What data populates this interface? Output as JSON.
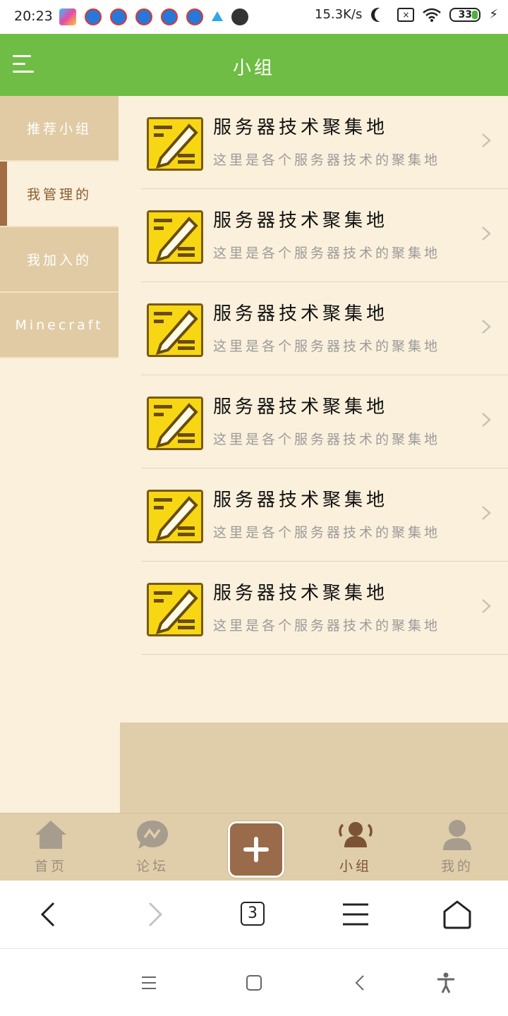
{
  "status_bar": {
    "time": "20:23",
    "net_speed": "15.3K/s",
    "battery": "33"
  },
  "header": {
    "title": "小组"
  },
  "sidebar": {
    "items": [
      {
        "label": "推荐小组",
        "active": false
      },
      {
        "label": "我管理的",
        "active": true
      },
      {
        "label": "我加入的",
        "active": false
      },
      {
        "label": "Minecraft",
        "active": false
      }
    ]
  },
  "groups": [
    {
      "title": "服务器技术聚集地",
      "desc": "这里是各个服务器技术的聚集地"
    },
    {
      "title": "服务器技术聚集地",
      "desc": "这里是各个服务器技术的聚集地"
    },
    {
      "title": "服务器技术聚集地",
      "desc": "这里是各个服务器技术的聚集地"
    },
    {
      "title": "服务器技术聚集地",
      "desc": "这里是各个服务器技术的聚集地"
    },
    {
      "title": "服务器技术聚集地",
      "desc": "这里是各个服务器技术的聚集地"
    },
    {
      "title": "服务器技术聚集地",
      "desc": "这里是各个服务器技术的聚集地"
    }
  ],
  "tabbar": {
    "home": "首页",
    "forum": "论坛",
    "groups": "小组",
    "mine": "我的"
  },
  "browser": {
    "tab_count": "3"
  },
  "colors": {
    "header": "#6fbd44",
    "accent": "#996b4a",
    "background": "#fbf0dc",
    "panel": "#e0ceaa"
  }
}
